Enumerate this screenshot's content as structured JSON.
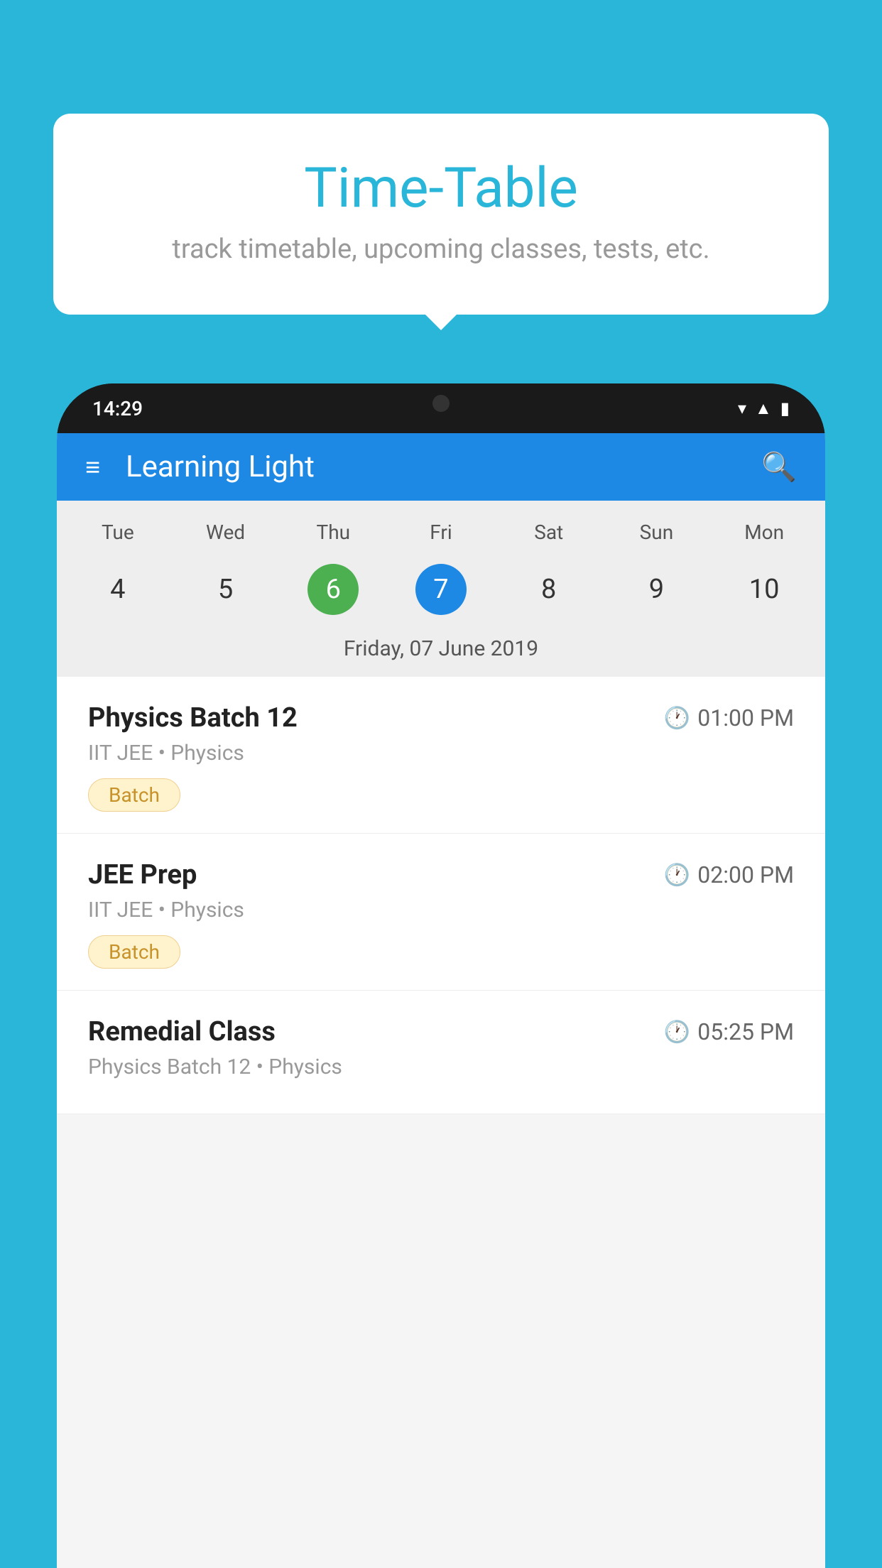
{
  "background_color": "#29B6D8",
  "speech_bubble": {
    "title": "Time-Table",
    "subtitle": "track timetable, upcoming classes, tests, etc."
  },
  "phone": {
    "status_bar": {
      "time": "14:29",
      "icons": [
        "wifi",
        "signal",
        "battery"
      ]
    },
    "app_header": {
      "title": "Learning Light"
    },
    "calendar": {
      "days": [
        "Tue",
        "Wed",
        "Thu",
        "Fri",
        "Sat",
        "Sun",
        "Mon"
      ],
      "dates": [
        "4",
        "5",
        "6",
        "7",
        "8",
        "9",
        "10"
      ],
      "today_index": 2,
      "selected_index": 3,
      "selected_date_label": "Friday, 07 June 2019"
    },
    "schedule_items": [
      {
        "title": "Physics Batch 12",
        "time": "01:00 PM",
        "subtitle": "IIT JEE • Physics",
        "badge": "Batch"
      },
      {
        "title": "JEE Prep",
        "time": "02:00 PM",
        "subtitle": "IIT JEE • Physics",
        "badge": "Batch"
      },
      {
        "title": "Remedial Class",
        "time": "05:25 PM",
        "subtitle": "Physics Batch 12 • Physics",
        "badge": null
      }
    ]
  }
}
